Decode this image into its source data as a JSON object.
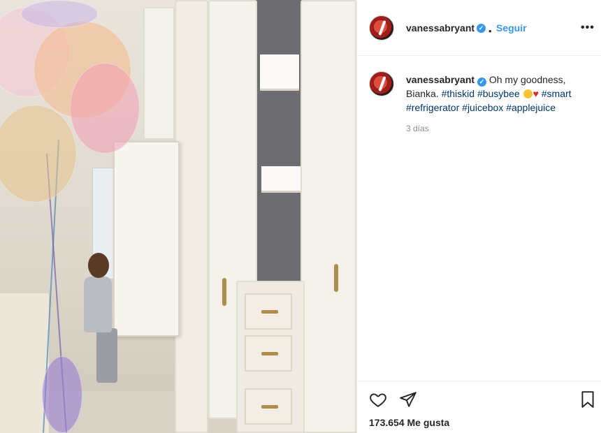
{
  "post": {
    "author": "vanessabryant",
    "verified_mark": "✓",
    "separator": "•",
    "follow_label": "Seguir",
    "more_label": "•••"
  },
  "caption": {
    "author": "vanessabryant",
    "text_start": "Oh my goodness, Bianka.",
    "tags": [
      "#thiskid",
      "#busybee",
      "#smart",
      "#refrigerator",
      "#juicebox",
      "#applejuice"
    ],
    "timestamp": "3 días"
  },
  "footer": {
    "likes_text": "173.654 Me gusta"
  },
  "icons": {
    "avatar": "profile-avatar",
    "like": "heart-icon",
    "share": "send-icon",
    "save": "bookmark-icon",
    "more": "more-options-icon"
  },
  "colors": {
    "link_blue": "#3897f0",
    "hashtag": "#00376b",
    "muted": "#8e8e8e",
    "text": "#262626"
  }
}
